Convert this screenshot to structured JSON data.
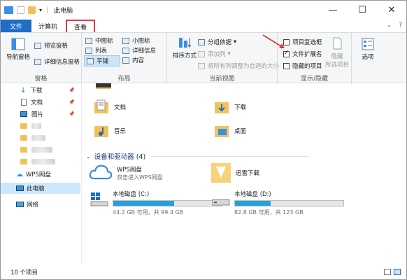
{
  "title": "此电脑",
  "window_buttons": {
    "min": "—",
    "max": "☐",
    "close": "✕"
  },
  "tabs": {
    "file": "文件",
    "computer": "计算机",
    "view": "查看"
  },
  "tabs_right": {
    "chevron": "⌄",
    "help": "?"
  },
  "ribbon": {
    "panes": {
      "label": "窗格",
      "nav_pane": "导航窗格",
      "preview": "预览窗格",
      "details": "详细信息窗格"
    },
    "layout": {
      "label": "布局",
      "medium": "中图标",
      "small": "小图标",
      "list": "列表",
      "details": "详细信息",
      "tiles": "平铺",
      "content": "内容"
    },
    "current_view": {
      "label": "当前视图",
      "sort": "排序方式",
      "group": "分组依据",
      "add_col": "添加列",
      "fit_cols": "将所有列调整为合适的大小"
    },
    "showhide": {
      "label": "显示/隐藏",
      "item_checkboxes": "项目复选框",
      "file_ext": "文件扩展名",
      "hidden_items": "隐藏的项目",
      "hide": "隐藏",
      "selected_items": "所选项目"
    },
    "options": "选项",
    "checks": {
      "item_checkboxes": false,
      "file_ext": true,
      "hidden_items": false
    }
  },
  "nav": {
    "download": "下载",
    "docs": "文档",
    "pics": "图片",
    "wps": "WPS网盘",
    "thispc": "此电脑",
    "network": "网络"
  },
  "content": {
    "docs": "文档",
    "download": "下载",
    "music": "音乐",
    "desktop": "桌面",
    "section_title": "设备和驱动器 (4)",
    "wps_name": "WPS网盘",
    "wps_sub": "双击进入WPS网盘",
    "xunlei": "迅雷下载",
    "drive_c": {
      "name": "本地磁盘 (C:)",
      "free": "44.2 GB 可用，共 99.4 GB",
      "used_fraction": 0.56
    },
    "drive_d": {
      "name": "本地磁盘 (D:)",
      "free": "82.8 GB 可用，共 123 GB",
      "used_fraction": 0.33
    }
  },
  "status": "10 个项目",
  "colors": {
    "accent": "#1e6ec7",
    "highlight": "#e23b3b",
    "drive_bar": "#26a0da",
    "folder": "#f0c35a"
  }
}
